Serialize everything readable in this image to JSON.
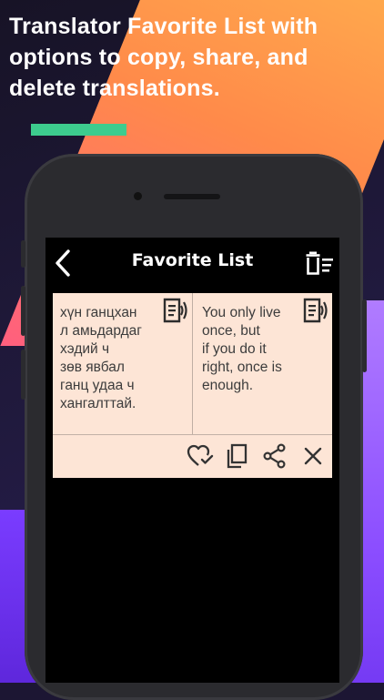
{
  "caption": "Translator Favorite List with options to copy, share, and delete translations.",
  "app": {
    "title": "Favorite List"
  },
  "favorites": [
    {
      "source_text": "хүн ганцхан\nл амьдардаг\nхэдий ч\nзөв явбал\nганц удаа ч\nхангалттай.",
      "translated_text": "You only live\nonce, but\nif you do it\nright, once is\nenough."
    }
  ],
  "icons": {
    "back": "back-arrow-icon",
    "clear": "clear-all-icon",
    "speaker": "speaker-icon",
    "favorite": "heart-check-icon",
    "copy": "copy-icon",
    "share": "share-icon",
    "delete": "close-icon"
  },
  "colors": {
    "accent": "#3dcc8e",
    "card": "#fde5d6",
    "screen": "#000000"
  }
}
